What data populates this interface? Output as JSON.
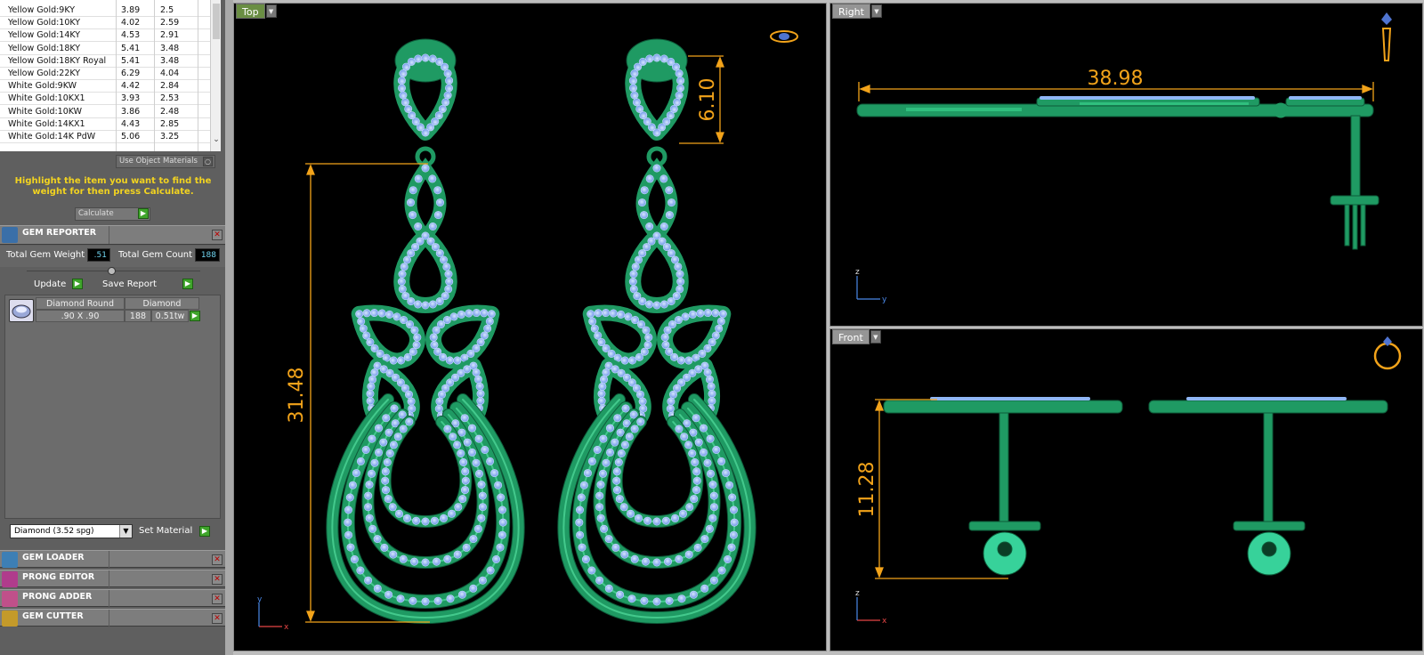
{
  "materials": [
    {
      "name": "Yellow Gold:9KY",
      "a": "3.89",
      "b": "2.5"
    },
    {
      "name": "Yellow Gold:10KY",
      "a": "4.02",
      "b": "2.59"
    },
    {
      "name": "Yellow Gold:14KY",
      "a": "4.53",
      "b": "2.91"
    },
    {
      "name": "Yellow Gold:18KY",
      "a": "5.41",
      "b": "3.48"
    },
    {
      "name": "Yellow Gold:18KY Royal",
      "a": "5.41",
      "b": "3.48"
    },
    {
      "name": "Yellow Gold:22KY",
      "a": "6.29",
      "b": "4.04"
    },
    {
      "name": "White Gold:9KW",
      "a": "4.42",
      "b": "2.84"
    },
    {
      "name": "White Gold:10KX1",
      "a": "3.93",
      "b": "2.53"
    },
    {
      "name": "White Gold:10KW",
      "a": "3.86",
      "b": "2.48"
    },
    {
      "name": "White Gold:14KX1",
      "a": "4.43",
      "b": "2.85"
    },
    {
      "name": "White Gold:14K PdW",
      "a": "5.06",
      "b": "3.25"
    }
  ],
  "use_object_materials": "Use Object Materials",
  "hint": "Highlight the item you want to find the weight for then press Calculate.",
  "calculate": "Calculate",
  "gem_reporter": {
    "title": "GEM REPORTER",
    "weight_label": "Total Gem Weight",
    "weight_value": ".51",
    "count_label": "Total Gem Count",
    "count_value": "188",
    "update": "Update",
    "save_report": "Save Report",
    "row": {
      "shape": "Diamond Round",
      "type": "Diamond",
      "size": ".90 X .90",
      "count": "188",
      "weight": "0.51tw"
    }
  },
  "material_select": "Diamond    (3.52 spg)",
  "set_material": "Set Material",
  "sections": [
    "GEM LOADER",
    "PRONG EDITOR",
    "PRONG ADDER",
    "GEM CUTTER"
  ],
  "viewports": {
    "top": {
      "label": "Top",
      "dim_height": "31.48",
      "dim_top": "6.10"
    },
    "right": {
      "label": "Right",
      "dim_width": "38.98"
    },
    "front": {
      "label": "Front",
      "dim_height": "11.28"
    }
  },
  "colors": {
    "metal": "#1f9a63",
    "gem": "#8fb6f5",
    "dimension": "#f2a31a"
  }
}
